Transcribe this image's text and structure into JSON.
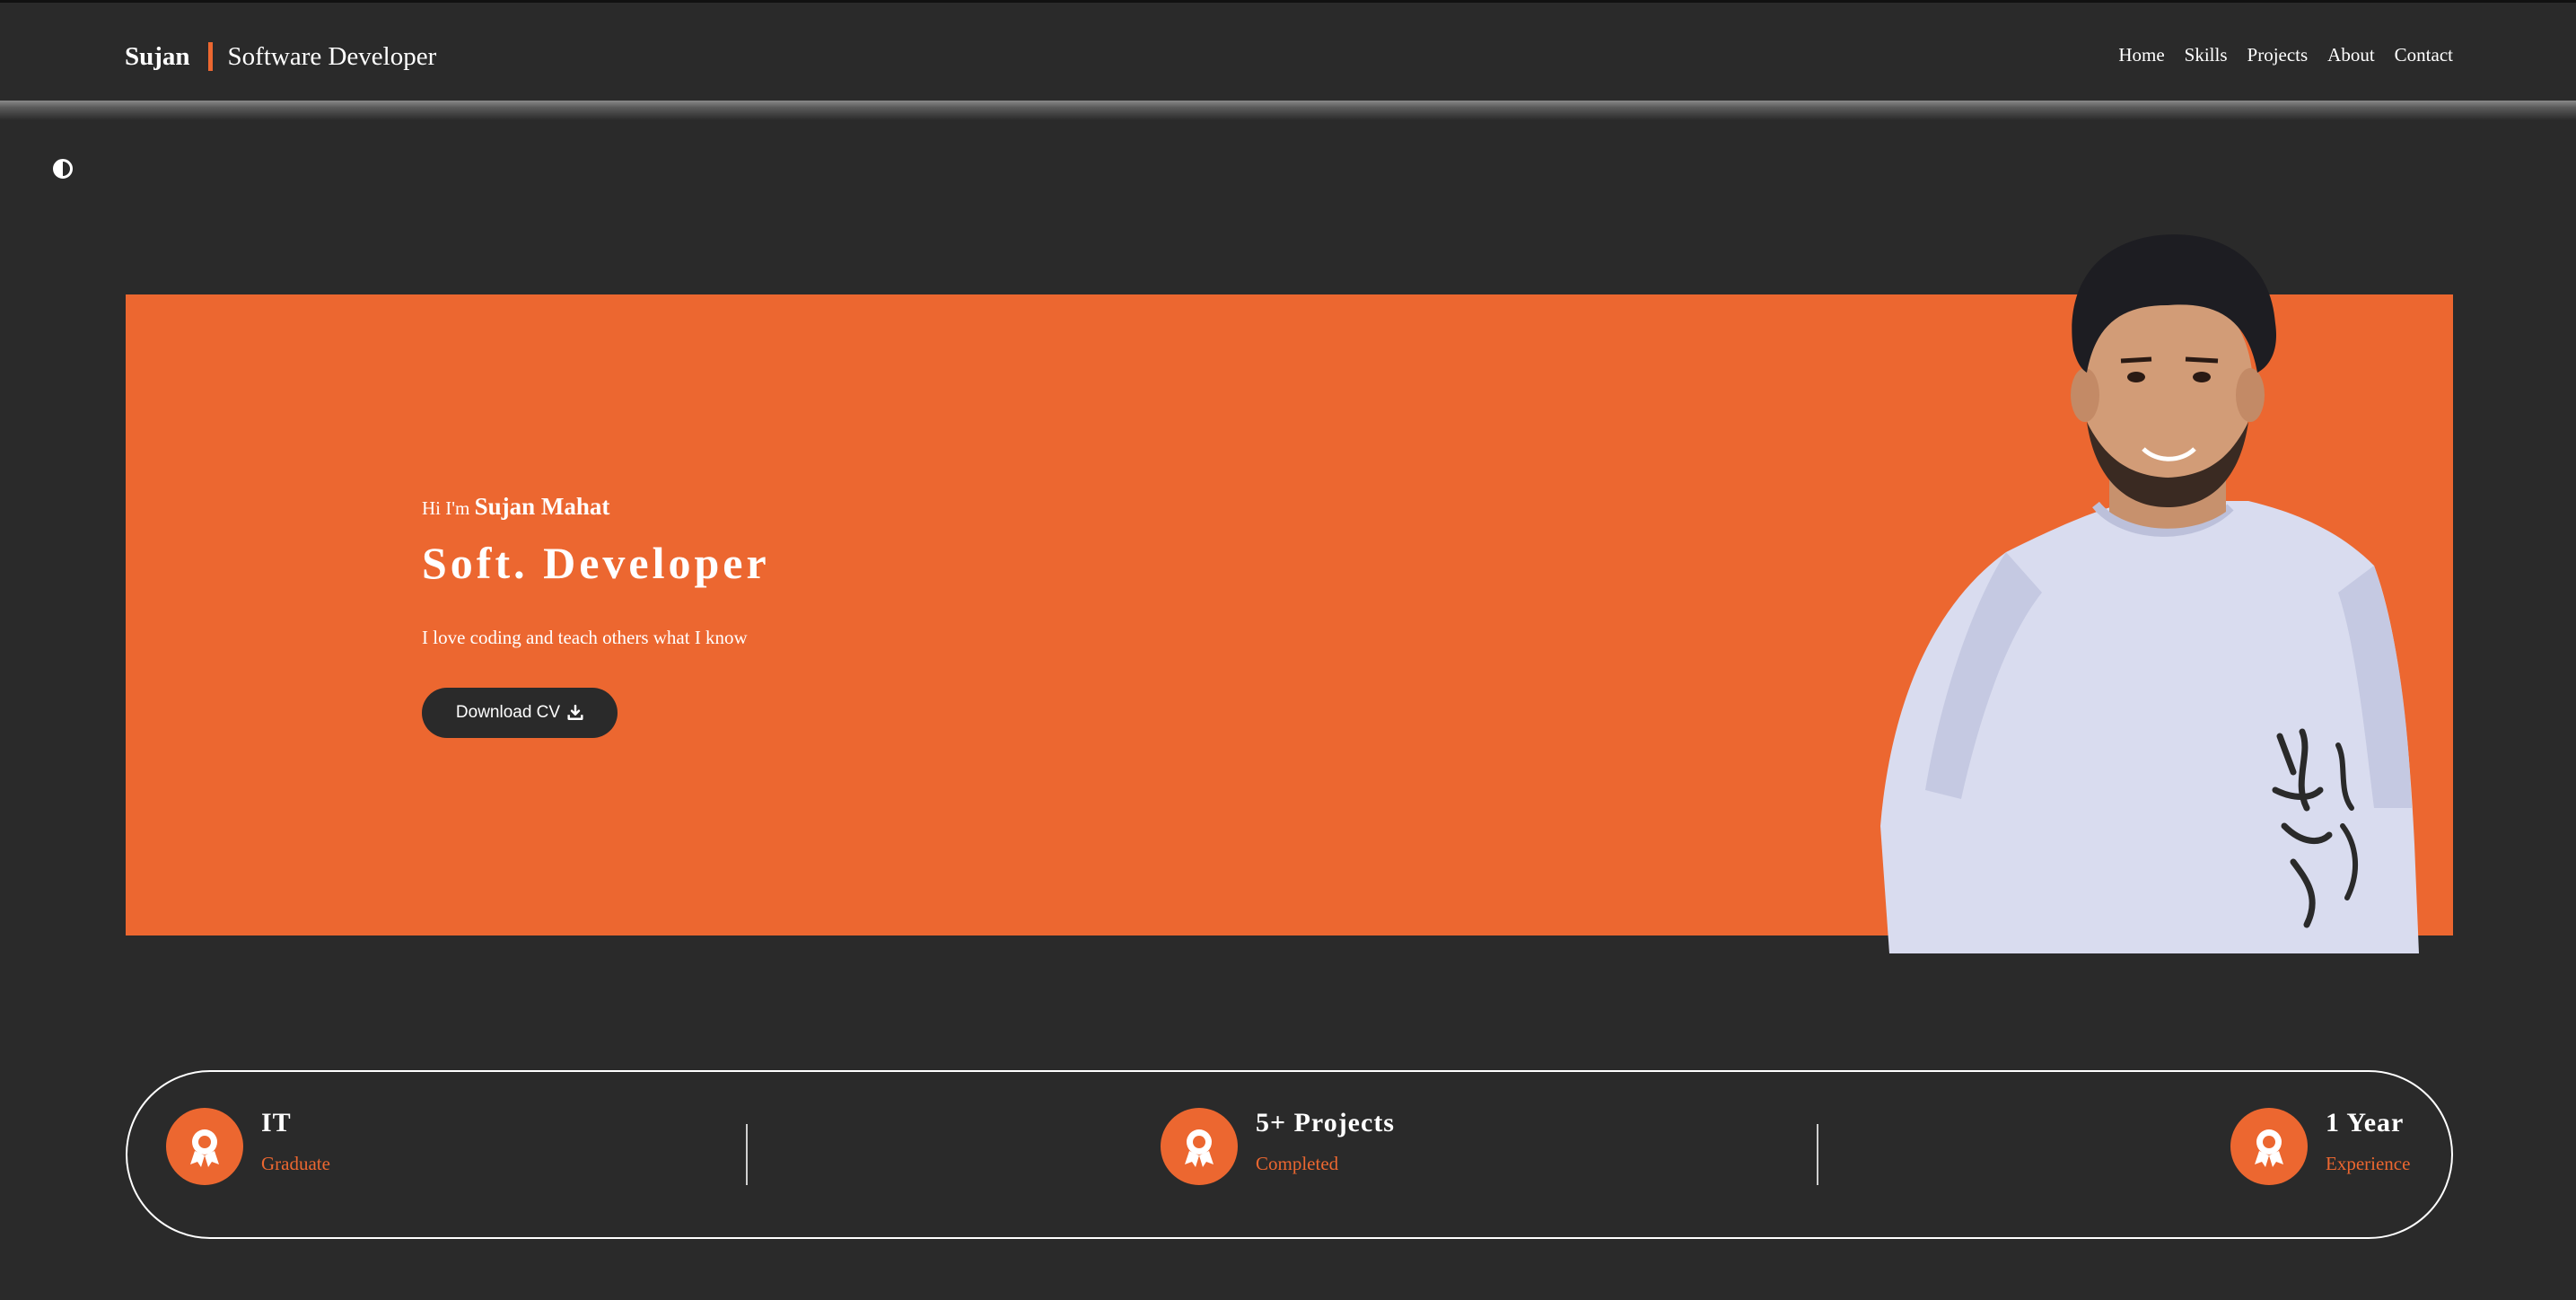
{
  "header": {
    "brand_name": "Sujan",
    "brand_role": "Software Developer",
    "nav": [
      "Home",
      "Skills",
      "Projects",
      "About",
      "Contact"
    ]
  },
  "theme_toggle": {
    "icon": "half-circle-contrast-icon"
  },
  "hero": {
    "greeting_prefix": "Hi I'm",
    "greeting_name": "Sujan Mahat",
    "title": "Soft. Developer",
    "tagline": "I love coding and teach others what I know",
    "cta_label": "Download CV",
    "cta_icon": "download-icon",
    "portrait": "person-photo"
  },
  "stats": [
    {
      "title": "IT",
      "subtitle": "Graduate",
      "icon": "award-ribbon-icon"
    },
    {
      "title": "5+ Projects",
      "subtitle": "Completed",
      "icon": "award-ribbon-icon"
    },
    {
      "title": "1 Year",
      "subtitle": "Experience",
      "icon": "award-ribbon-icon"
    }
  ],
  "colors": {
    "background": "#2a2a2a",
    "accent": "#ec6730",
    "text": "#ffffff"
  }
}
